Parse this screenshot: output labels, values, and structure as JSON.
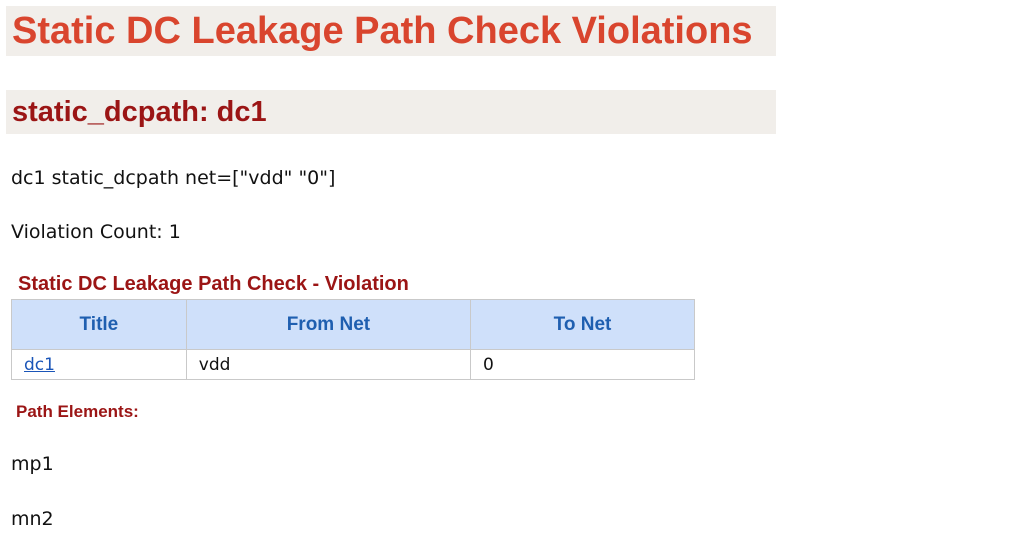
{
  "page_title": "Static DC Leakage Path Check Violations",
  "section_title": "static_dcpath: dc1",
  "net_line": "dc1 static_dcpath net=[\"vdd\" \"0\"]",
  "violation_count": "Violation Count: 1",
  "table": {
    "caption": "Static DC Leakage Path Check - Violation",
    "headers": [
      "Title",
      "From Net",
      "To Net"
    ],
    "rows": [
      {
        "title": "dc1",
        "from_net": "vdd",
        "to_net": "0"
      }
    ],
    "link_color": "#1a55b8",
    "header_bg": "#cfe0fa"
  },
  "path_elements_label": "Path Elements:",
  "path_elements": [
    "mp1",
    "mn2"
  ],
  "colors": {
    "title_red": "#d9452e",
    "section_red": "#9b1515",
    "banner_bg": "#f1eeea"
  }
}
